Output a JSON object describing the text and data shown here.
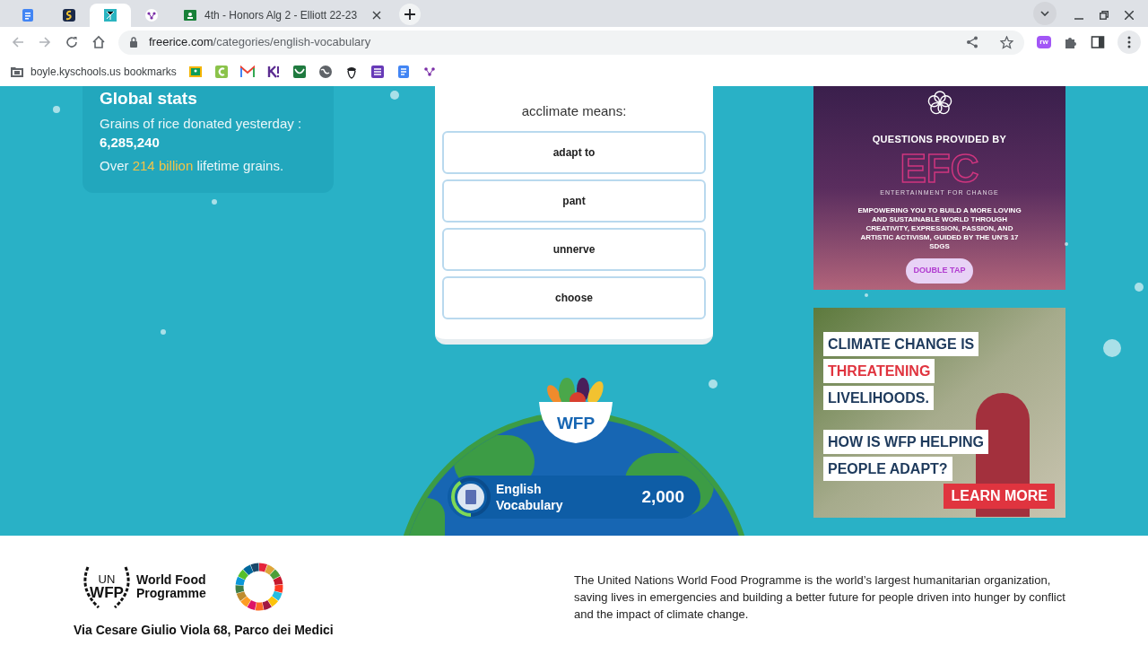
{
  "tabs": [
    {
      "selected": false
    },
    {
      "selected": false
    },
    {
      "selected": true
    },
    {
      "selected": false
    },
    {
      "title": "4th - Honors Alg 2 - Elliott 22-23",
      "selected": false
    }
  ],
  "address_bar": {
    "domain": "freerice.com",
    "path": "/categories/english-vocabulary"
  },
  "extension_badge": "rw",
  "bookmarks_bar": {
    "folder": "boyle.kyschools.us bookmarks"
  },
  "global_stats": {
    "title": "Global stats",
    "label": "Grains of rice donated yesterday :",
    "value": "6,285,240",
    "lifetime_prefix": "Over",
    "lifetime_highlight": "214 billion",
    "lifetime_suffix": "lifetime grains."
  },
  "quiz": {
    "question": "acclimate means:",
    "options": [
      "adapt to",
      "pant",
      "unnerve",
      "choose"
    ]
  },
  "bowl_label": "WFP",
  "category": {
    "name": "English Vocabulary",
    "level": 0.4,
    "score": "2,000"
  },
  "ads": [
    {
      "kind": "efc",
      "heading": "QUESTIONS PROVIDED BY",
      "logo": "EFC",
      "logo_caption": "ENTERTAINMENT FOR CHANGE",
      "body": "EMPOWERING YOU TO BUILD A MORE LOVING AND SUSTAINABLE WORLD THROUGH CREATIVITY, EXPRESSION, PASSION, AND ARTISTIC ACTIVISM, GUIDED BY THE UN'S 17 SDGS",
      "button": "DOUBLE TAP"
    },
    {
      "kind": "wfp",
      "lines": [
        "CLIMATE CHANGE IS",
        "THREATENING",
        "LIVELIHOODS.",
        "HOW IS WFP HELPING",
        "PEOPLE ADAPT?"
      ],
      "button": "LEARN MORE"
    }
  ],
  "footer": {
    "logo_un": "UN",
    "logo_wfp": "WFP",
    "logo_name": [
      "World Food",
      "Programme"
    ],
    "address": "Via Cesare Giulio Viola 68, Parco dei Medici",
    "description": "The United Nations World Food Programme is the world’s largest humanitarian organization, saving lives in emergencies and building a better future for people driven into hunger by conflict and the impact of climate change."
  }
}
